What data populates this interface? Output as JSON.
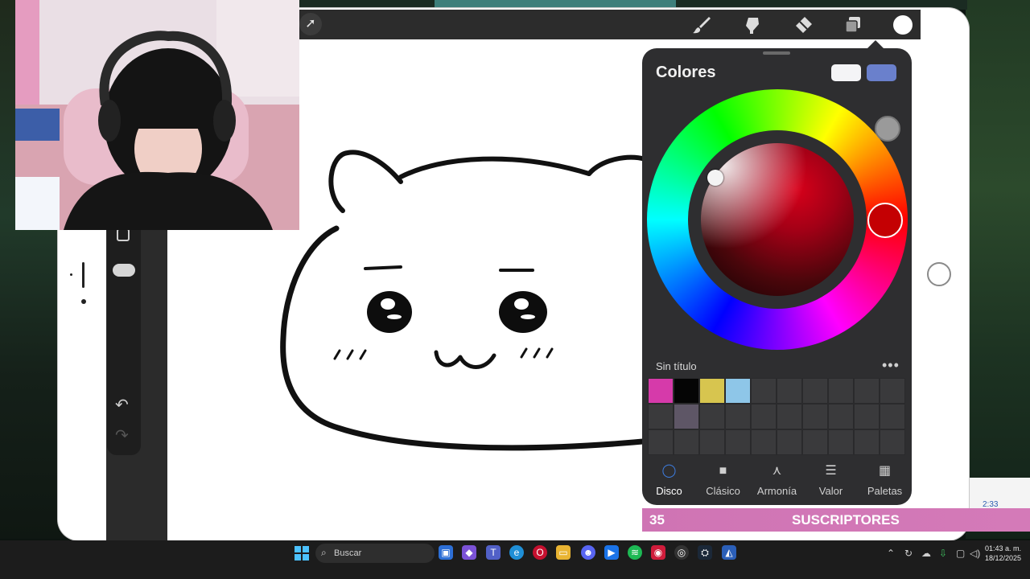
{
  "app": {
    "panel_title": "Colores",
    "palette_name": "Sin título",
    "palette_more": "•••"
  },
  "colors": {
    "current": "#f4f4f6",
    "previous": "#6a80cc",
    "selected_hue": "#c40003",
    "subscriber_banner": "#d17ab8",
    "accent": "#3d7de0"
  },
  "toolbar": {
    "icons": [
      "brush-icon",
      "smudge-icon",
      "eraser-icon",
      "layers-icon",
      "color-icon"
    ]
  },
  "palette": {
    "swatches": [
      "#d63aaa",
      "#050505",
      "#d7c54f",
      "#8ec6e8",
      "",
      "",
      "",
      "",
      "",
      "",
      "",
      "#5e5666",
      "",
      "",
      "",
      "",
      "",
      "",
      "",
      "",
      "",
      "",
      "",
      "",
      "",
      "",
      "",
      "",
      "",
      ""
    ]
  },
  "tabs": [
    {
      "label": "Disco",
      "icon": "disc-icon",
      "active": true
    },
    {
      "label": "Clásico",
      "icon": "classic-icon",
      "active": false
    },
    {
      "label": "Armonía",
      "icon": "harmony-icon",
      "active": false
    },
    {
      "label": "Valor",
      "icon": "value-icon",
      "active": false
    },
    {
      "label": "Paletas",
      "icon": "palettes-icon",
      "active": false
    }
  ],
  "subscribers": {
    "count": "35",
    "label": "SUSCRIPTORES"
  },
  "notification": {
    "time": "2:33"
  },
  "taskbar": {
    "search_placeholder": "Buscar",
    "time": "01:43 a. m.",
    "date": "18/12/2025"
  }
}
